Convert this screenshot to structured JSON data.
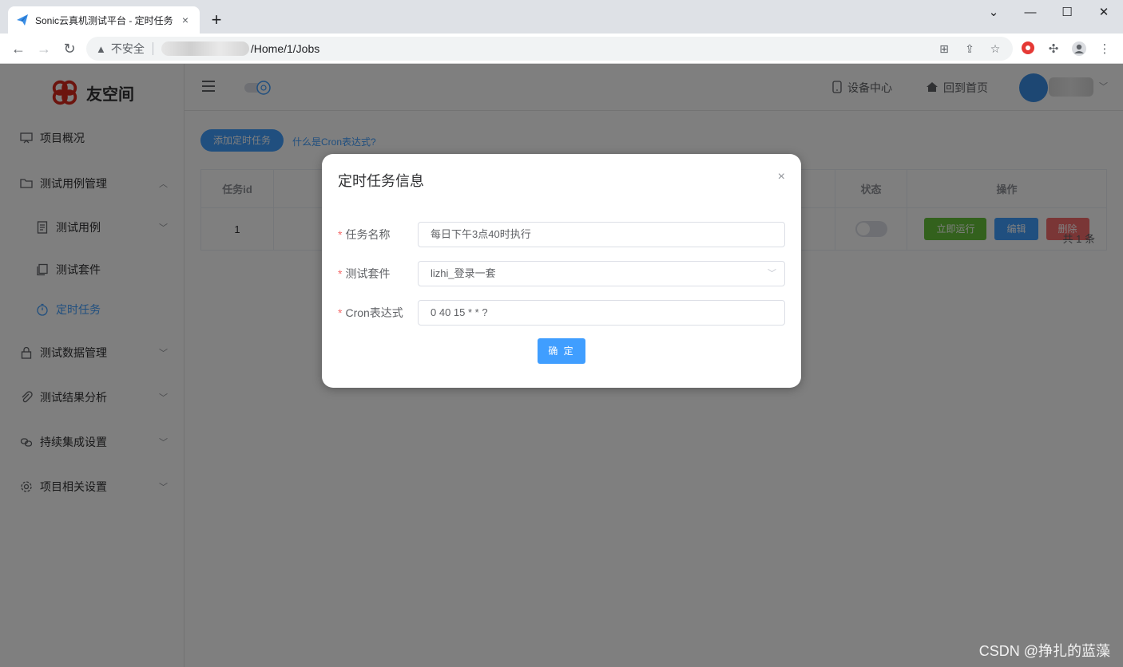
{
  "browser": {
    "tab_title": "Sonic云真机测试平台 - 定时任务",
    "tab_close": "×",
    "new_tab": "+",
    "security_label": "不安全",
    "url_path": "/Home/1/Jobs",
    "window_controls": [
      "⌄",
      "—",
      "☐",
      "✕"
    ]
  },
  "sidebar": {
    "logo_text": "友空间",
    "items": [
      {
        "label": "项目概况",
        "icon": "presentation-icon"
      },
      {
        "label": "测试用例管理",
        "icon": "folder-icon",
        "expanded": true
      },
      {
        "label": "测试用例",
        "icon": "document-icon"
      },
      {
        "label": "测试套件",
        "icon": "copy-icon"
      },
      {
        "label": "定时任务",
        "icon": "timer-icon",
        "active": true
      },
      {
        "label": "测试数据管理",
        "icon": "lock-icon"
      },
      {
        "label": "测试结果分析",
        "icon": "paperclip-icon"
      },
      {
        "label": "持续集成设置",
        "icon": "link-icon"
      },
      {
        "label": "项目相关设置",
        "icon": "gear-icon"
      }
    ]
  },
  "header": {
    "device_center": "设备中心",
    "home": "回到首页"
  },
  "content": {
    "add_button": "添加定时任务",
    "cron_help_link": "什么是Cron表达式?",
    "table": {
      "headers": {
        "id": "任务id",
        "status": "状态",
        "actions": "操作"
      },
      "rows": [
        {
          "id": "1",
          "status_on": false
        }
      ],
      "actions": {
        "run": "立即运行",
        "edit": "编辑",
        "delete": "删除"
      }
    },
    "total": "共 1 条"
  },
  "dialog": {
    "title": "定时任务信息",
    "close": "×",
    "fields": {
      "name_label": "任务名称",
      "name_value": "每日下午3点40时执行",
      "suite_label": "测试套件",
      "suite_value": "lizhi_登录一套",
      "cron_label": "Cron表达式",
      "cron_value": "0 40 15 * * ?"
    },
    "required_mark": "*",
    "confirm": "确 定"
  },
  "watermark": "CSDN @挣扎的蓝藻",
  "colors": {
    "primary": "#409eff",
    "success": "#67c23a",
    "danger": "#f56c6c",
    "overlay": "rgba(0,0,0,0.5)"
  }
}
